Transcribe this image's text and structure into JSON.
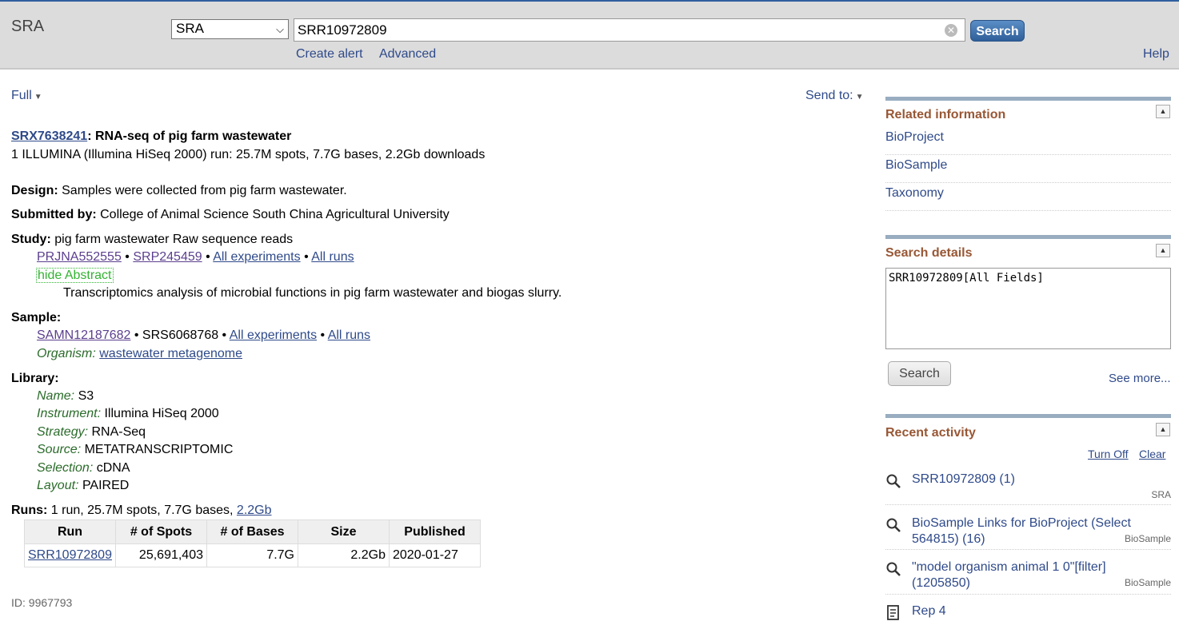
{
  "header": {
    "db_name": "SRA",
    "db_select": "SRA",
    "search_value": "SRR10972809",
    "search_button": "Search",
    "create_alert": "Create alert",
    "advanced": "Advanced",
    "help": "Help"
  },
  "toolbar": {
    "format": "Full",
    "send_to": "Send to:"
  },
  "record": {
    "accession": "SRX7638241",
    "title": ": RNA-seq of pig farm wastewater",
    "summary": "1 ILLUMINA (Illumina HiSeq 2000) run: 25.7M spots, 7.7G bases, 2.2Gb downloads",
    "design_label": "Design:",
    "design": "Samples were collected from pig farm wastewater.",
    "submitted_label": "Submitted by:",
    "submitted": "College of Animal Science South China Agricultural University",
    "study_label": "Study:",
    "study": "pig farm wastewater Raw sequence reads",
    "study_links": {
      "bioproject": "PRJNA552555",
      "srp": "SRP245459",
      "all_experiments": "All experiments",
      "all_runs": "All runs"
    },
    "hide_abstract": "hide Abstract",
    "abstract": "Transcriptomics analysis of microbial functions in pig farm wastewater and biogas slurry.",
    "sample_label": "Sample:",
    "sample_links": {
      "biosample": "SAMN12187682",
      "srs": "SRS6068768",
      "all_experiments": "All experiments",
      "all_runs": "All runs"
    },
    "organism_label": "Organism:",
    "organism": "wastewater metagenome",
    "library_label": "Library:",
    "library": {
      "name_label": "Name:",
      "name": "S3",
      "instrument_label": "Instrument:",
      "instrument": "Illumina HiSeq 2000",
      "strategy_label": "Strategy:",
      "strategy": "RNA-Seq",
      "source_label": "Source:",
      "source": "METATRANSCRIPTOMIC",
      "selection_label": "Selection:",
      "selection": "cDNA",
      "layout_label": "Layout:",
      "layout": "PAIRED"
    },
    "runs_label": "Runs:",
    "runs_summary": "1 run, 25.7M spots, 7.7G bases,",
    "runs_link": "2.2Gb",
    "runs_table": {
      "headers": [
        "Run",
        "# of Spots",
        "# of Bases",
        "Size",
        "Published"
      ],
      "rows": [
        [
          "SRR10972809",
          "25,691,403",
          "7.7G",
          "2.2Gb",
          "2020-01-27"
        ]
      ]
    },
    "id": "ID: 9967793"
  },
  "sidebar": {
    "related": {
      "title": "Related information",
      "items": [
        "BioProject",
        "BioSample",
        "Taxonomy"
      ]
    },
    "details": {
      "title": "Search details",
      "query": "SRR10972809[All Fields]",
      "search_button": "Search",
      "see_more": "See more..."
    },
    "activity": {
      "title": "Recent activity",
      "turn_off": "Turn Off",
      "clear": "Clear",
      "items": [
        {
          "text": "SRR10972809 (1)",
          "db": "SRA",
          "icon": "search-icon"
        },
        {
          "text": "BioSample Links for BioProject (Select 564815) (16)",
          "db": "BioSample",
          "icon": "search-icon"
        },
        {
          "text": "\"model organism animal 1 0\"[filter] (1205850)",
          "db": "BioSample",
          "icon": "search-icon"
        },
        {
          "text": "Rep 4",
          "db": "",
          "icon": "document-icon"
        }
      ]
    }
  }
}
